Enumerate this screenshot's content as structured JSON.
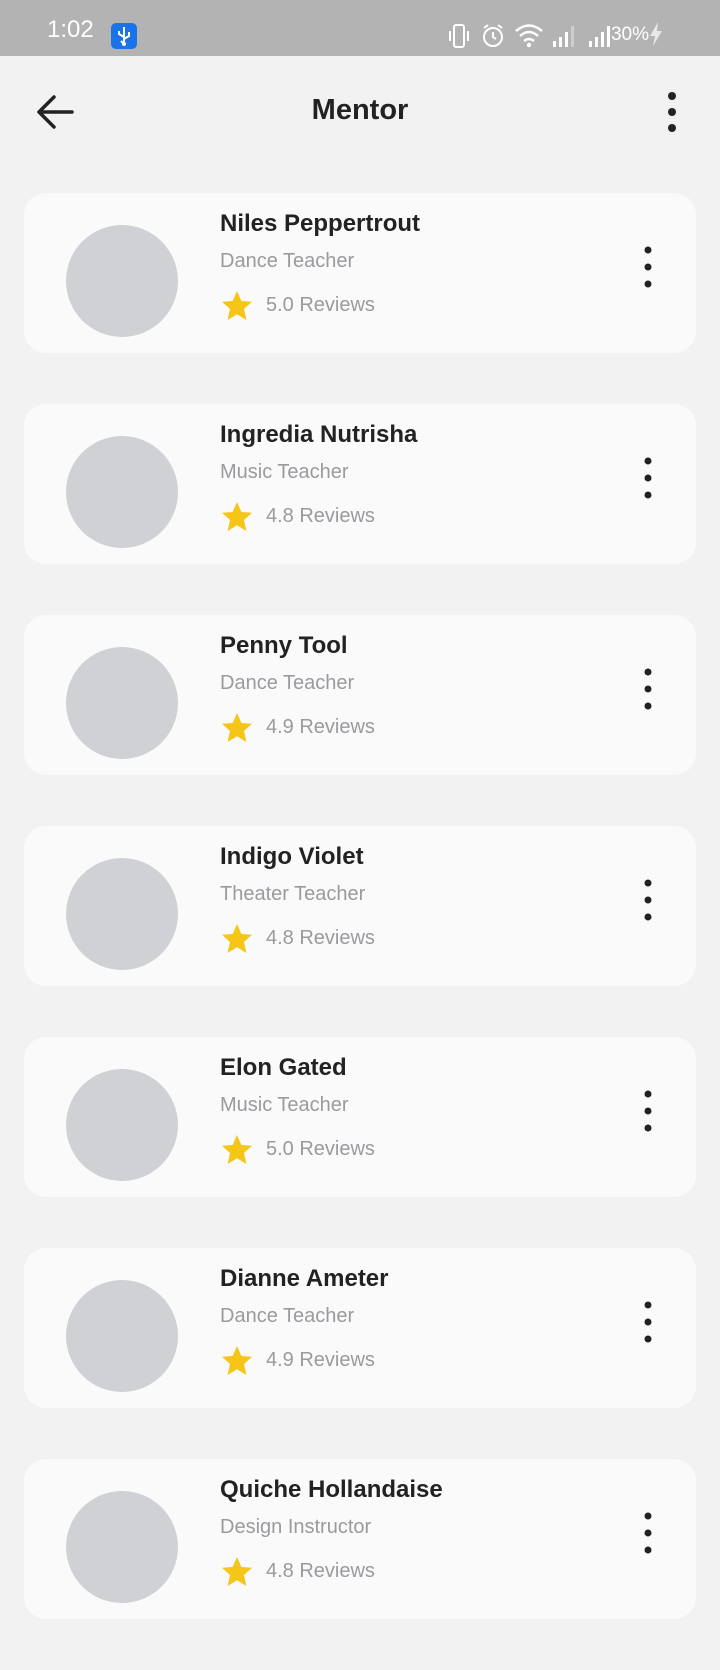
{
  "status_bar": {
    "time": "1:02",
    "battery": "30%"
  },
  "header": {
    "title": "Mentor"
  },
  "colors": {
    "status_bar_bg": "#b3b3b3",
    "page_bg": "#f2f2f2",
    "card_bg": "#fafafa",
    "avatar_placeholder": "#d0d1d4",
    "star": "#f5c518",
    "title_text": "#222222",
    "secondary_text": "#9a9a9f"
  },
  "mentors": [
    {
      "name": "Niles Peppertrout",
      "role": "Dance Teacher",
      "rating": "5.0 Reviews"
    },
    {
      "name": "Ingredia Nutrisha",
      "role": "Music Teacher",
      "rating": "4.8 Reviews"
    },
    {
      "name": "Penny Tool",
      "role": "Dance Teacher",
      "rating": "4.9 Reviews"
    },
    {
      "name": "Indigo Violet",
      "role": "Theater Teacher",
      "rating": "4.8 Reviews"
    },
    {
      "name": "Elon Gated",
      "role": "Music Teacher",
      "rating": "5.0 Reviews"
    },
    {
      "name": "Dianne Ameter",
      "role": "Dance Teacher",
      "rating": "4.9 Reviews"
    },
    {
      "name": "Quiche Hollandaise",
      "role": "Design Instructor",
      "rating": "4.8 Reviews"
    }
  ]
}
